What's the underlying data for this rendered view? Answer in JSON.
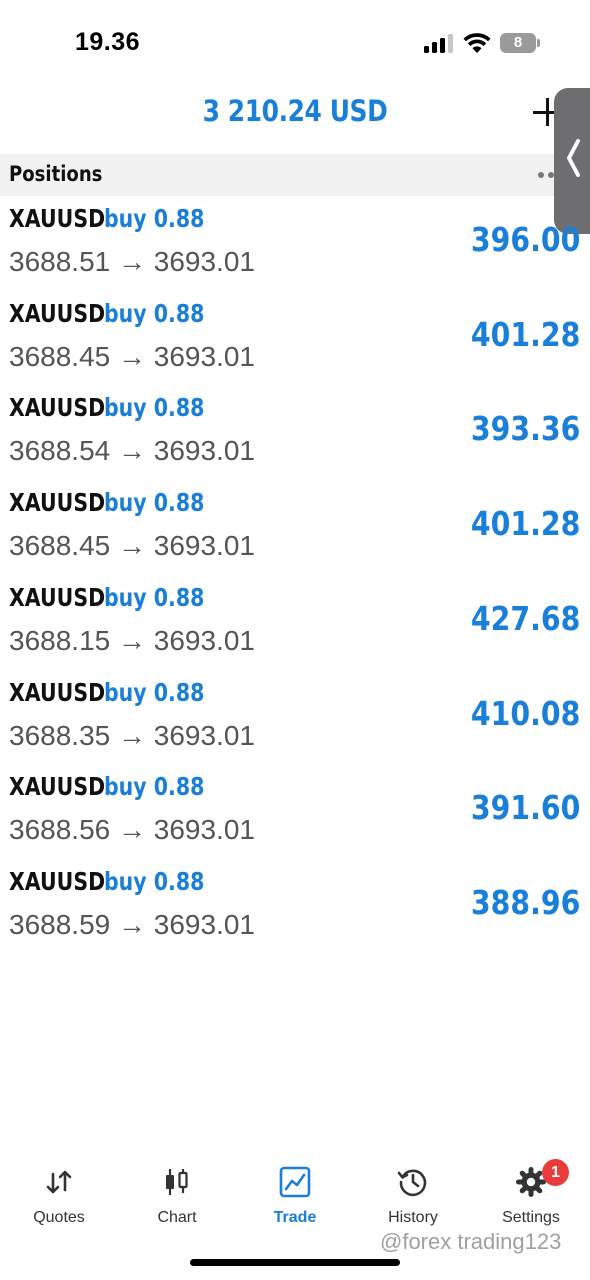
{
  "status_bar": {
    "time": "19.36",
    "battery": "8",
    "icons": [
      "cellular-signal-icon",
      "wifi-icon",
      "battery-icon"
    ]
  },
  "header": {
    "balance": "3 210.24 USD",
    "add_icon": "plus-icon"
  },
  "section": {
    "title": "Positions",
    "more_icon": "more-dots-icon",
    "side_handle_icon": "chevron-left-icon"
  },
  "positions": [
    {
      "symbol": "XAUUSD",
      "side": "buy 0.88",
      "prices": "3688.51 → 3693.01",
      "profit": "396.00"
    },
    {
      "symbol": "XAUUSD",
      "side": "buy 0.88",
      "prices": "3688.45 → 3693.01",
      "profit": "401.28"
    },
    {
      "symbol": "XAUUSD",
      "side": "buy 0.88",
      "prices": "3688.54 → 3693.01",
      "profit": "393.36"
    },
    {
      "symbol": "XAUUSD",
      "side": "buy 0.88",
      "prices": "3688.45 → 3693.01",
      "profit": "401.28"
    },
    {
      "symbol": "XAUUSD",
      "side": "buy 0.88",
      "prices": "3688.15 → 3693.01",
      "profit": "427.68"
    },
    {
      "symbol": "XAUUSD",
      "side": "buy 0.88",
      "prices": "3688.35 → 3693.01",
      "profit": "410.08"
    },
    {
      "symbol": "XAUUSD",
      "side": "buy 0.88",
      "prices": "3688.56 → 3693.01",
      "profit": "391.60"
    },
    {
      "symbol": "XAUUSD",
      "side": "buy 0.88",
      "prices": "3688.59 → 3693.01",
      "profit": "388.96"
    }
  ],
  "tabs": [
    {
      "label": "Quotes",
      "icon": "quotes-arrows-icon",
      "active": false
    },
    {
      "label": "Chart",
      "icon": "candlestick-chart-icon",
      "active": false
    },
    {
      "label": "Trade",
      "icon": "trade-chart-icon",
      "active": true
    },
    {
      "label": "History",
      "icon": "history-clock-icon",
      "active": false
    },
    {
      "label": "Settings",
      "icon": "gear-icon",
      "active": false
    }
  ],
  "settings_badge": "1",
  "watermark": "@forex trading123",
  "colors": {
    "accent": "#1a7fd8",
    "text": "#111111",
    "secondary_text": "#555555",
    "badge": "#ea3b3b",
    "section_background": "#f1f1f1"
  }
}
